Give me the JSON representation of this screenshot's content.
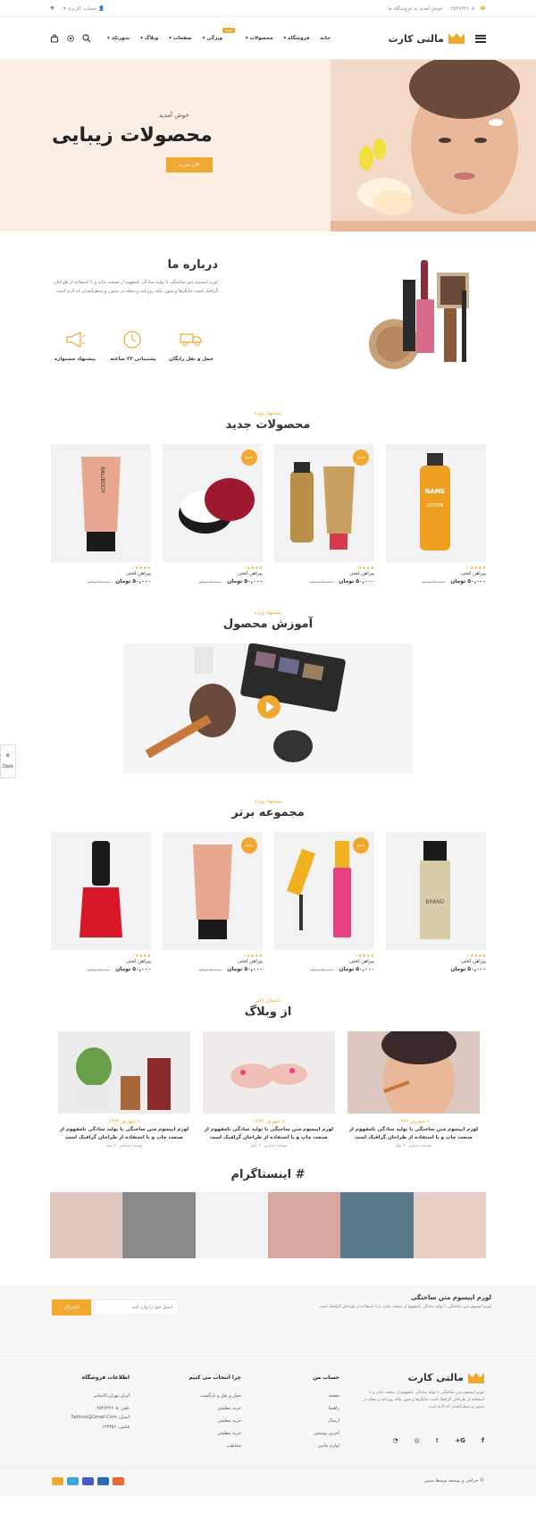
{
  "topbar": {
    "welcome": "خوش آمدید به فروشگاه ما",
    "phone": "۰۲۵۳۶۲۲۶۰۵",
    "account": "حساب کاربری"
  },
  "header": {
    "logo": "مالتی کارت",
    "nav": [
      "خانه",
      "فروشگاه",
      "محصولات",
      "ویژگی",
      "صفحات",
      "وبلاگ",
      "شورتکد"
    ],
    "badge": "جدید"
  },
  "hero": {
    "subtitle": "خوش آمدید",
    "title": "محصولات زیبایی",
    "button": "الان بخرید"
  },
  "about": {
    "title": "درباره ما",
    "text": "لورم ایپسوم متن ساختگی با تولید سادگی نامفهوم از صنعت چاپ و با استفاده از طراحان گرافیک است چاپگرها و متون بلکه روزنامه و مجله در ستون و سطرآنچنان که لازم است",
    "features": [
      "حمل و نقل رایگان",
      "پشتیبانی ۲۴ ساعته",
      "پیشنهاد جشنواره"
    ]
  },
  "new_products": {
    "subtitle": "پیشنهاد ویژه",
    "title": "محصولات جدید",
    "new_label": "جدید",
    "items": [
      {
        "name": "پیراهن لختی",
        "price": "۵۰,۰۰۰ تومان",
        "old": "۷۰,۰۰۰ تومان"
      },
      {
        "name": "پیراهن لختی",
        "price": "۵۰,۰۰۰ تومان",
        "old": "۷۰,۰۰۰ تومان"
      },
      {
        "name": "پیراهن لختی",
        "price": "۵۰,۰۰۰ تومان",
        "old": "۷۰,۰۰۰ تومان"
      },
      {
        "name": "پیراهن لختی",
        "price": "۵۰,۰۰۰ تومان",
        "old": "۷۰,۰۰۰ تومان"
      }
    ]
  },
  "video": {
    "subtitle": "پیشنهاد ویژه",
    "title": "آموزش محصول"
  },
  "top_collection": {
    "subtitle": "پیشنهاد ویژه",
    "title": "مجموعه برتر",
    "items": [
      {
        "name": "پیراهن لختی",
        "price": "۵۰,۰۰۰ تومان",
        "old": ""
      },
      {
        "name": "پیراهن لختی",
        "price": "۵۰,۰۰۰ تومان",
        "old": "۷۰,۰۰۰ تومان"
      },
      {
        "name": "پیراهن لختی",
        "price": "۵۰,۰۰۰ تومان",
        "old": "۷۰,۰۰۰ تومان"
      },
      {
        "name": "پیراهن لختی",
        "price": "۵۰,۰۰۰ تومان",
        "old": "۷۰,۰۰۰ تومان"
      }
    ]
  },
  "blog": {
    "subtitle": "داستان اخیر",
    "title": "از وبلاگ",
    "posts": [
      {
        "date": "۸ شهریور ۱۳۹۹",
        "title": "لورم ایپسوم متن ساختگی با تولید سادگی نامفهوم از صنعت چاپ و با استفاده از طراحان گرافیک است",
        "meta": "نوشته دستایبر ۲۰ نظر"
      },
      {
        "date": "۸ شهریور ۱۳۹۹",
        "title": "لورم ایپسوم متن ساختگی با تولید سادگی نامفهوم از صنعت چاپ و با استفاده از طراحان گرافیک است",
        "meta": "نوشته دستایبر ۲۰ نظر"
      },
      {
        "date": "۸ شهریور ۱۳۹۹",
        "title": "لورم ایپسوم متن ساختگی با تولید سادگی نامفهوم از صنعت چاپ و با استفاده از طراحان گرافیک است",
        "meta": "نوشته دستایبر ۲۰ نظر"
      }
    ]
  },
  "instagram": {
    "title": "# اینستاگرام"
  },
  "newsletter": {
    "title": "لورم ایپسوم متن ساختگی",
    "text": "لورم ایپسوم متن ساختگی با تولید سادگی نامفهوم از صنعت چاپ، و با استفاده از طراحان گرافیک است",
    "placeholder": "ایمیل خود را وارد کنید",
    "button": "اشتراک"
  },
  "footer": {
    "logo": "مالتی کارت",
    "about": "لورم ایپسوم متن ساختگی با تولید سادگی نامفهوم از صنعت چاپ و با استفاده از طراحان گرافیک است چاپگرها و متون بلکه روزنامه و مجله در ستون و سطرآنچنان که لازم است",
    "account_title": "حساب من",
    "account_links": [
      "صفحه",
      "راهنما",
      "ارسال",
      "آخرین پوشش",
      "لوازم جانبی"
    ],
    "why_title": "چرا انتخاب می کنیم",
    "why_links": [
      "حمل و نقل و بازگشت",
      "خرید مطمئن",
      "خرید مطمئن",
      "خرید مطمئن",
      "مخاطب"
    ],
    "info_title": "اطلاعات فروشگاه",
    "info": [
      "ایران،تهران،کاشانی",
      "تلفن: ۰۲۵۳۶۲۲۶۰۵",
      "ایمیل: Setinco@Gmail.Com",
      "فکس: ۱۲۳۴۵۶"
    ],
    "copyright": "© حراجی و توسعه توسط ستین"
  },
  "dark_label": "Dark",
  "colors": {
    "accent": "#f0a830"
  }
}
